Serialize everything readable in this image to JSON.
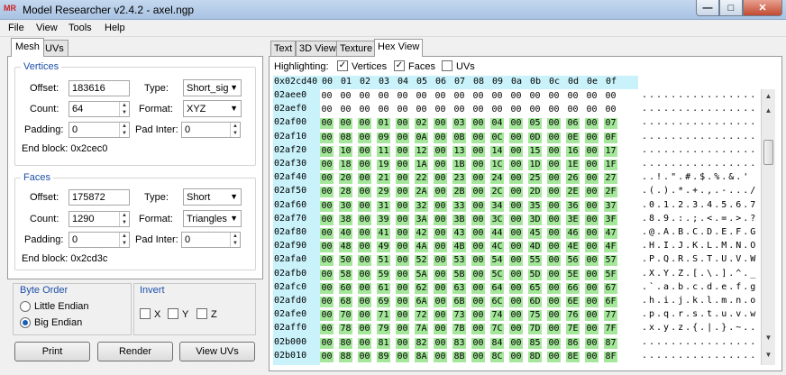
{
  "window": {
    "title": "Model Researcher v2.4.2 - axel.ngp",
    "app_icon": "MR"
  },
  "menu": [
    "File",
    "View",
    "Tools",
    "Help"
  ],
  "left_tabs": [
    "Mesh",
    "UVs"
  ],
  "vertices": {
    "title": "Vertices",
    "offset_label": "Offset:",
    "offset": "183616",
    "type_label": "Type:",
    "type": "Short_sig",
    "count_label": "Count:",
    "count": "64",
    "format_label": "Format:",
    "format": "XYZ",
    "padding_label": "Padding:",
    "padding": "0",
    "padinter_label": "Pad Inter:",
    "padinter": "0",
    "endblock": "End block: 0x2cec0"
  },
  "faces": {
    "title": "Faces",
    "offset_label": "Offset:",
    "offset": "175872",
    "type_label": "Type:",
    "type": "Short",
    "count_label": "Count:",
    "count": "1290",
    "format_label": "Format:",
    "format": "Triangles",
    "padding_label": "Padding:",
    "padding": "0",
    "padinter_label": "Pad Inter:",
    "padinter": "0",
    "endblock": "End block: 0x2cd3c"
  },
  "byte_order": {
    "title": "Byte Order",
    "little": "Little Endian",
    "big": "Big Endian",
    "selected": "big"
  },
  "invert": {
    "title": "Invert",
    "x": "X",
    "y": "Y",
    "z": "Z"
  },
  "buttons": {
    "print": "Print",
    "render": "Render",
    "viewuvs": "View UVs"
  },
  "right_tabs": [
    "Text",
    "3D View",
    "Texture",
    "Hex View"
  ],
  "highlighting": {
    "label": "Highlighting:",
    "vertices": "Vertices",
    "faces": "Faces",
    "uvs": "UVs",
    "vertices_checked": true,
    "faces_checked": true,
    "uvs_checked": false
  },
  "hex_header": {
    "addr": "0x02cd40",
    "cols": [
      "00",
      "01",
      "02",
      "03",
      "04",
      "05",
      "06",
      "07",
      "08",
      "09",
      "0a",
      "0b",
      "0c",
      "0d",
      "0e",
      "0f"
    ]
  },
  "highlight_color": "#a4e79a",
  "hex_rows": [
    {
      "addr": "02aee0",
      "hl": false,
      "bytes": [
        "00",
        "00",
        "00",
        "00",
        "00",
        "00",
        "00",
        "00",
        "00",
        "00",
        "00",
        "00",
        "00",
        "00",
        "00",
        "00"
      ],
      "ascii": "................"
    },
    {
      "addr": "02aef0",
      "hl": false,
      "bytes": [
        "00",
        "00",
        "00",
        "00",
        "00",
        "00",
        "00",
        "00",
        "00",
        "00",
        "00",
        "00",
        "00",
        "00",
        "00",
        "00"
      ],
      "ascii": "................"
    },
    {
      "addr": "02af00",
      "hl": true,
      "bytes": [
        "00",
        "00",
        "00",
        "01",
        "00",
        "02",
        "00",
        "03",
        "00",
        "04",
        "00",
        "05",
        "00",
        "06",
        "00",
        "07"
      ],
      "ascii": "................"
    },
    {
      "addr": "02af10",
      "hl": true,
      "bytes": [
        "00",
        "08",
        "00",
        "09",
        "00",
        "0A",
        "00",
        "0B",
        "00",
        "0C",
        "00",
        "0D",
        "00",
        "0E",
        "00",
        "0F"
      ],
      "ascii": "................"
    },
    {
      "addr": "02af20",
      "hl": true,
      "bytes": [
        "00",
        "10",
        "00",
        "11",
        "00",
        "12",
        "00",
        "13",
        "00",
        "14",
        "00",
        "15",
        "00",
        "16",
        "00",
        "17"
      ],
      "ascii": "................"
    },
    {
      "addr": "02af30",
      "hl": true,
      "bytes": [
        "00",
        "18",
        "00",
        "19",
        "00",
        "1A",
        "00",
        "1B",
        "00",
        "1C",
        "00",
        "1D",
        "00",
        "1E",
        "00",
        "1F"
      ],
      "ascii": "................"
    },
    {
      "addr": "02af40",
      "hl": true,
      "bytes": [
        "00",
        "20",
        "00",
        "21",
        "00",
        "22",
        "00",
        "23",
        "00",
        "24",
        "00",
        "25",
        "00",
        "26",
        "00",
        "27"
      ],
      "ascii": "..!.\".#.$.%.&.'"
    },
    {
      "addr": "02af50",
      "hl": true,
      "bytes": [
        "00",
        "28",
        "00",
        "29",
        "00",
        "2A",
        "00",
        "2B",
        "00",
        "2C",
        "00",
        "2D",
        "00",
        "2E",
        "00",
        "2F"
      ],
      "ascii": ".(.).*.+.,.-.../"
    },
    {
      "addr": "02af60",
      "hl": true,
      "bytes": [
        "00",
        "30",
        "00",
        "31",
        "00",
        "32",
        "00",
        "33",
        "00",
        "34",
        "00",
        "35",
        "00",
        "36",
        "00",
        "37"
      ],
      "ascii": ".0.1.2.3.4.5.6.7"
    },
    {
      "addr": "02af70",
      "hl": true,
      "bytes": [
        "00",
        "38",
        "00",
        "39",
        "00",
        "3A",
        "00",
        "3B",
        "00",
        "3C",
        "00",
        "3D",
        "00",
        "3E",
        "00",
        "3F"
      ],
      "ascii": ".8.9.:.;.<.=.>.?"
    },
    {
      "addr": "02af80",
      "hl": true,
      "bytes": [
        "00",
        "40",
        "00",
        "41",
        "00",
        "42",
        "00",
        "43",
        "00",
        "44",
        "00",
        "45",
        "00",
        "46",
        "00",
        "47"
      ],
      "ascii": ".@.A.B.C.D.E.F.G"
    },
    {
      "addr": "02af90",
      "hl": true,
      "bytes": [
        "00",
        "48",
        "00",
        "49",
        "00",
        "4A",
        "00",
        "4B",
        "00",
        "4C",
        "00",
        "4D",
        "00",
        "4E",
        "00",
        "4F"
      ],
      "ascii": ".H.I.J.K.L.M.N.O"
    },
    {
      "addr": "02afa0",
      "hl": true,
      "bytes": [
        "00",
        "50",
        "00",
        "51",
        "00",
        "52",
        "00",
        "53",
        "00",
        "54",
        "00",
        "55",
        "00",
        "56",
        "00",
        "57"
      ],
      "ascii": ".P.Q.R.S.T.U.V.W"
    },
    {
      "addr": "02afb0",
      "hl": true,
      "bytes": [
        "00",
        "58",
        "00",
        "59",
        "00",
        "5A",
        "00",
        "5B",
        "00",
        "5C",
        "00",
        "5D",
        "00",
        "5E",
        "00",
        "5F"
      ],
      "ascii": ".X.Y.Z.[.\\.].^._"
    },
    {
      "addr": "02afc0",
      "hl": true,
      "bytes": [
        "00",
        "60",
        "00",
        "61",
        "00",
        "62",
        "00",
        "63",
        "00",
        "64",
        "00",
        "65",
        "00",
        "66",
        "00",
        "67"
      ],
      "ascii": ".`.a.b.c.d.e.f.g"
    },
    {
      "addr": "02afd0",
      "hl": true,
      "bytes": [
        "00",
        "68",
        "00",
        "69",
        "00",
        "6A",
        "00",
        "6B",
        "00",
        "6C",
        "00",
        "6D",
        "00",
        "6E",
        "00",
        "6F"
      ],
      "ascii": ".h.i.j.k.l.m.n.o"
    },
    {
      "addr": "02afe0",
      "hl": true,
      "bytes": [
        "00",
        "70",
        "00",
        "71",
        "00",
        "72",
        "00",
        "73",
        "00",
        "74",
        "00",
        "75",
        "00",
        "76",
        "00",
        "77"
      ],
      "ascii": ".p.q.r.s.t.u.v.w"
    },
    {
      "addr": "02aff0",
      "hl": true,
      "bytes": [
        "00",
        "78",
        "00",
        "79",
        "00",
        "7A",
        "00",
        "7B",
        "00",
        "7C",
        "00",
        "7D",
        "00",
        "7E",
        "00",
        "7F"
      ],
      "ascii": ".x.y.z.{.|.}.~.."
    },
    {
      "addr": "02b000",
      "hl": true,
      "bytes": [
        "00",
        "80",
        "00",
        "81",
        "00",
        "82",
        "00",
        "83",
        "00",
        "84",
        "00",
        "85",
        "00",
        "86",
        "00",
        "87"
      ],
      "ascii": "................"
    },
    {
      "addr": "02b010",
      "hl": true,
      "bytes": [
        "00",
        "88",
        "00",
        "89",
        "00",
        "8A",
        "00",
        "8B",
        "00",
        "8C",
        "00",
        "8D",
        "00",
        "8E",
        "00",
        "8F"
      ],
      "ascii": "................"
    }
  ]
}
